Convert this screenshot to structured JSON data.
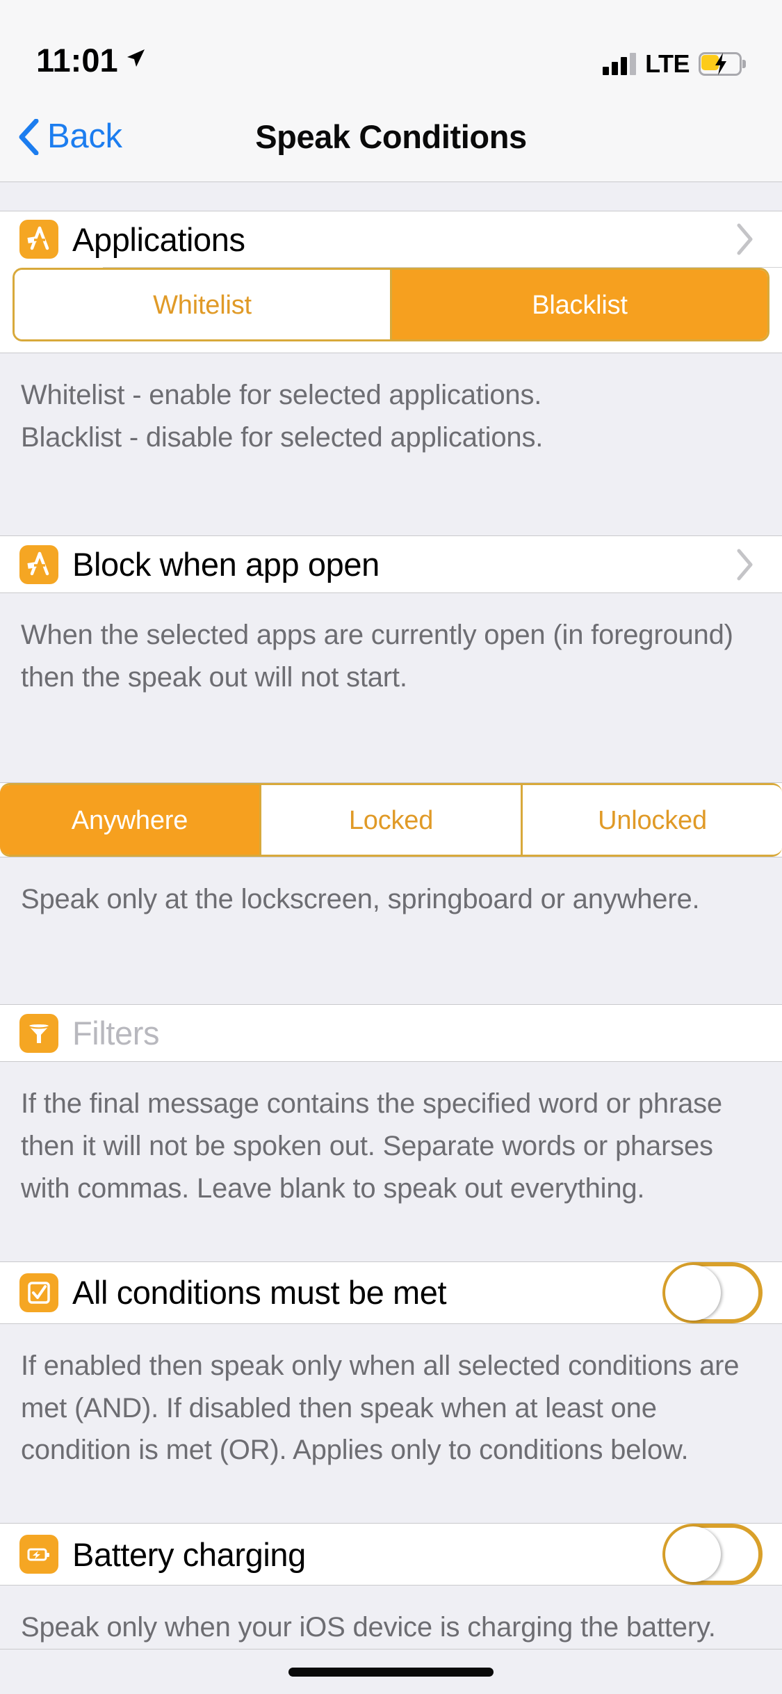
{
  "status_bar": {
    "time": "11:01",
    "carrier_network": "LTE",
    "location_icon": "location-arrow-icon",
    "signal_icon": "cellular-signal-bars-icon",
    "battery_icon": "battery-charging-icon"
  },
  "nav_bar": {
    "back_label": "Back",
    "back_icon": "chevron-left-icon",
    "title": "Speak Conditions"
  },
  "colors": {
    "accent_orange": "#F6A01F",
    "accent_border": "#D8A93B",
    "link_blue": "#1C7DEF",
    "group_bg": "#EFEFF4",
    "cell_bg": "#FFFFFF",
    "footer_text": "#6D6D72"
  },
  "sections": [
    {
      "row": {
        "title": "Applications",
        "icon": "app-store-icon",
        "accessory": "chevron-right-icon"
      },
      "segmented": {
        "options": [
          "Whitelist",
          "Blacklist"
        ],
        "selected": "Blacklist"
      },
      "footer": "Whitelist - enable for selected applications.\nBlacklist - disable for selected applications."
    },
    {
      "row": {
        "title": "Block when app open",
        "icon": "app-store-icon",
        "accessory": "chevron-right-icon"
      },
      "footer": "When the selected apps are currently open (in foreground) then the speak out will not start."
    },
    {
      "segmented": {
        "options": [
          "Anywhere",
          "Locked",
          "Unlocked"
        ],
        "selected": "Anywhere"
      },
      "footer": "Speak only at the lockscreen, springboard or anywhere."
    },
    {
      "row": {
        "title": "Filters",
        "is_placeholder": true,
        "icon": "funnel-filter-icon"
      },
      "footer": "If the final message contains the specified word or phrase then it will not be spoken out. Separate words or pharses with commas. Leave blank to speak out everything."
    },
    {
      "row": {
        "title": "All conditions must be met",
        "icon": "checkbox-checked-icon",
        "toggle": "off"
      },
      "footer": "If enabled then speak only when all selected conditions are met (AND). If disabled then speak when at least one condition is met (OR). Applies only to conditions below."
    },
    {
      "row": {
        "title": "Battery charging",
        "icon": "battery-bolt-icon",
        "toggle": "off"
      },
      "footer": "Speak only when your iOS device is charging the battery."
    }
  ],
  "texts": {
    "applications_title": "Applications",
    "whitelist": "Whitelist",
    "blacklist": "Blacklist",
    "desc_list": "Whitelist - enable for selected applications.",
    "desc_list2": "Blacklist - disable for selected applications.",
    "block_title": "Block when app open",
    "desc_block": "When the selected apps are currently open (in foreground) then the speak out will not start.",
    "anywhere": "Anywhere",
    "locked": "Locked",
    "unlocked": "Unlocked",
    "desc_where": "Speak only at the lockscreen, springboard or anywhere.",
    "filters_title": "Filters",
    "desc_filters": "If the final message contains the specified word or phrase then it will not be spoken out. Separate words or pharses with commas. Leave blank to speak out everything.",
    "allcond_title": "All conditions must be met",
    "desc_allcond": "If enabled then speak only when all selected conditions are met (AND). If disabled then speak when at least one condition is met (OR). Applies only to conditions below.",
    "battery_title": "Battery charging",
    "desc_battery": "Speak only when your iOS device is charging the battery."
  }
}
